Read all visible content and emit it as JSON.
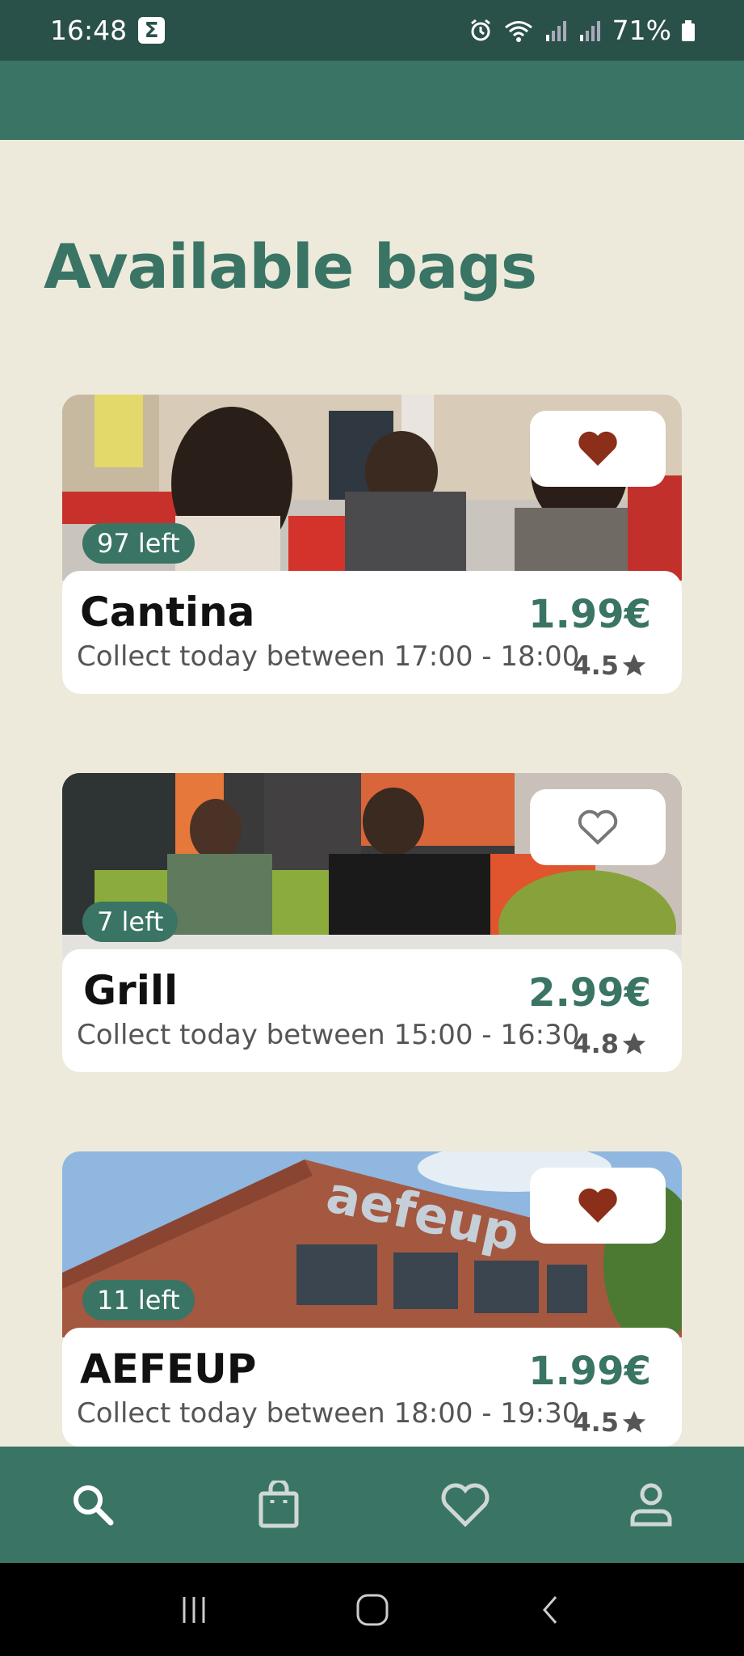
{
  "status_bar": {
    "time": "16:48",
    "battery": "71%"
  },
  "page": {
    "title": "Available bags"
  },
  "bags": [
    {
      "name": "Cantina",
      "collect": "Collect today between 17:00 - 18:00",
      "price": "1.99€",
      "rating": "4.5",
      "left": "97 left",
      "favorite": true
    },
    {
      "name": "Grill",
      "collect": "Collect today between 15:00 - 16:30",
      "price": "2.99€",
      "rating": "4.8",
      "left": "7 left",
      "favorite": false
    },
    {
      "name": "AEFEUP",
      "collect": "Collect today between 18:00 - 19:30",
      "price": "1.99€",
      "rating": "4.5",
      "left": "11 left",
      "favorite": true
    }
  ],
  "icons": {
    "favorite_on": "heart-filled-icon",
    "favorite_off": "heart-outline-icon",
    "rating": "star-icon"
  },
  "colors": {
    "primary": "#3a7465",
    "status_bar": "#2a5149",
    "background": "#edeadb",
    "heart": "#8b2e1a"
  },
  "nav": [
    "search",
    "bag",
    "favorites",
    "profile"
  ]
}
